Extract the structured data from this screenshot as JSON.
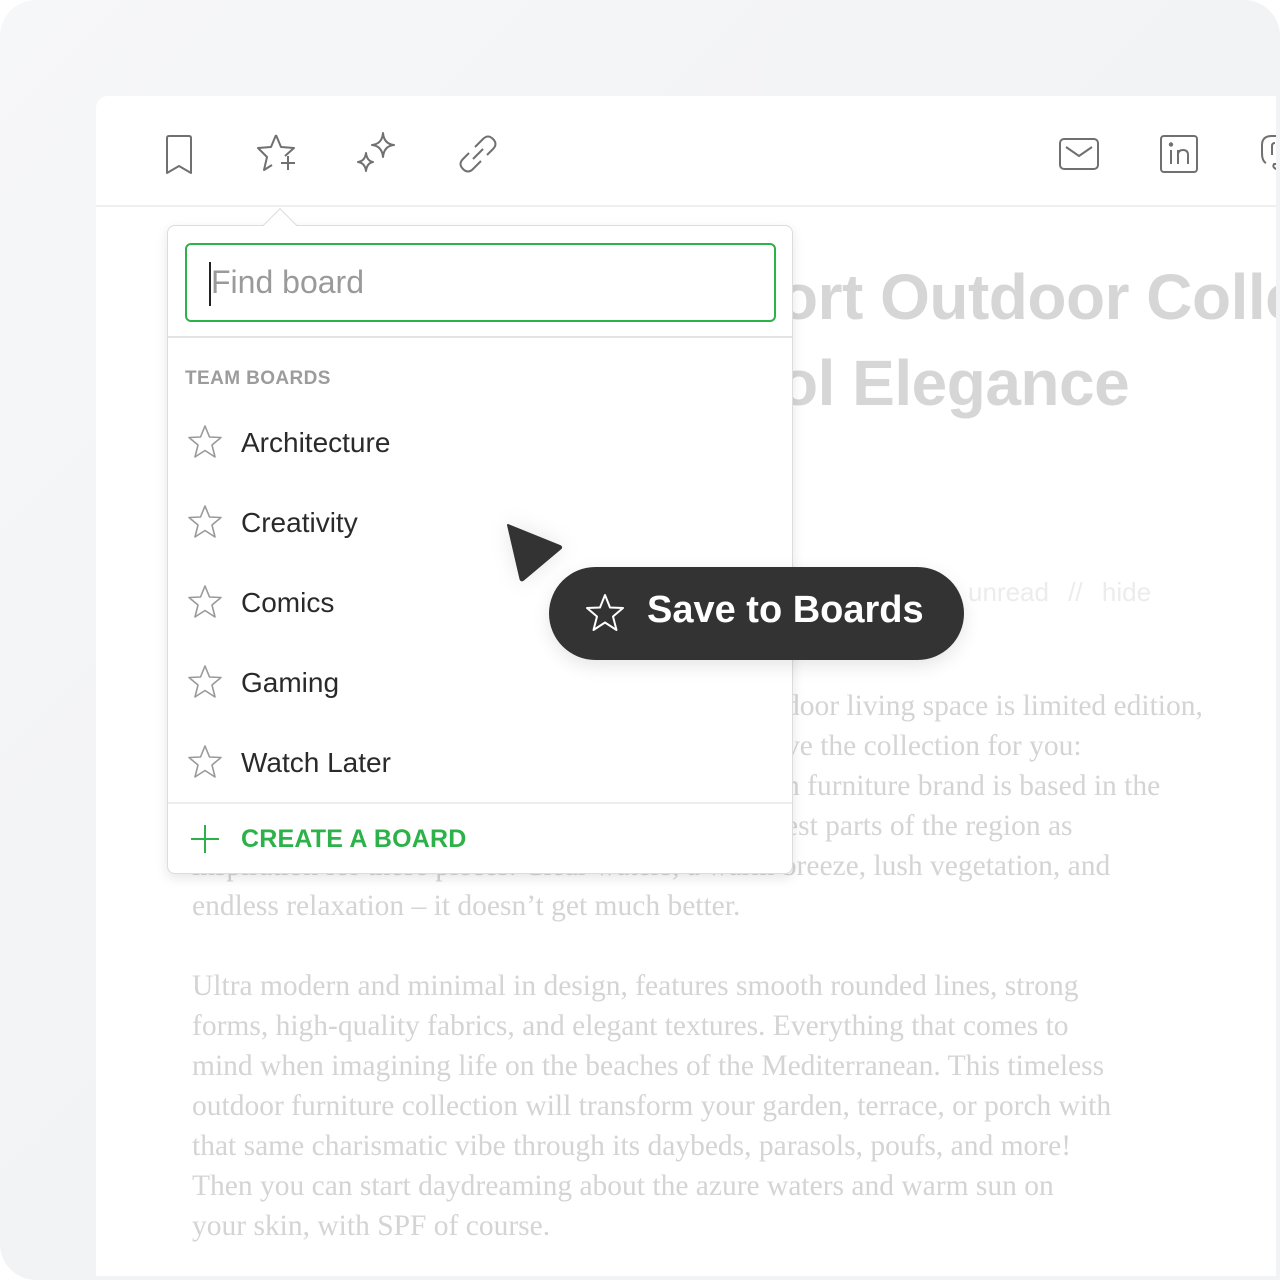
{
  "toolbar": {
    "left_icons": [
      {
        "name": "bookmark-icon",
        "title": "Bookmark"
      },
      {
        "name": "star-plus-icon",
        "title": "Save to Boards"
      },
      {
        "name": "sparkles-icon",
        "title": "Highlights"
      },
      {
        "name": "link-icon",
        "title": "Copy link"
      }
    ],
    "right_icons": [
      {
        "name": "mail-icon",
        "title": "Email"
      },
      {
        "name": "linkedin-icon",
        "title": "LinkedIn"
      },
      {
        "name": "mastodon-icon",
        "title": "Mastodon"
      }
    ]
  },
  "article": {
    "title_line_1": "…ort Outdoor Colle",
    "title_line_2": "…ol Elegance",
    "meta": {
      "unread": "unread",
      "separator": "//",
      "hide": "hide"
    },
    "paragraph_1_lines": [
      "door living space is limited edition,",
      "ve the collection for you:",
      "n furniture brand is based in the",
      "est parts of the region as",
      "inspiration for these pieces. Clear waters, a warm breeze, lush vegetation, and",
      "endless relaxation – it doesn’t get much better."
    ],
    "paragraph_2_lines": [
      "Ultra modern and minimal in design, features smooth rounded lines, strong",
      "forms, high-quality fabrics, and elegant textures. Everything that comes to",
      "mind when imagining life on the beaches of the Mediterranean. This timeless",
      "outdoor furniture collection will transform your garden, terrace, or porch with",
      "that same charismatic vibe through its daybeds, parasols, poufs, and more!",
      "Then you can start daydreaming about the azure waters and warm sun on",
      "your skin, with SPF of course."
    ]
  },
  "popover": {
    "search": {
      "value": "",
      "placeholder": "Find board"
    },
    "section_label": "TEAM BOARDS",
    "boards": [
      {
        "label": "Architecture",
        "icon": "star-outline-icon"
      },
      {
        "label": "Creativity",
        "icon": "star-outline-icon"
      },
      {
        "label": "Comics",
        "icon": "star-outline-icon"
      },
      {
        "label": "Gaming",
        "icon": "star-outline-icon"
      },
      {
        "label": "Watch Later",
        "icon": "star-outline-icon"
      }
    ],
    "create_label": "CREATE A BOARD",
    "accent_color": "#2db24a"
  },
  "tooltip": {
    "label": "Save to Boards",
    "background": "#333333"
  }
}
